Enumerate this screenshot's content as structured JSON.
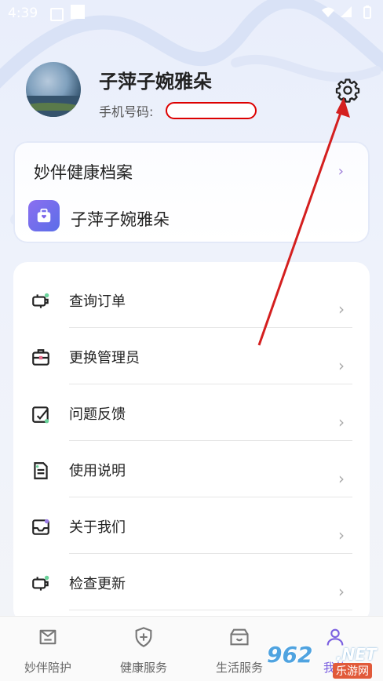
{
  "status_bar": {
    "time": "4:39"
  },
  "profile": {
    "name": "子萍子婉雅朵",
    "phone_label": "手机号码:"
  },
  "health_card": {
    "title": "妙伴健康档案",
    "chevron": "›",
    "record_name": "子萍子婉雅朵"
  },
  "menu": {
    "chevron": "›",
    "items": [
      {
        "label": "查询订单",
        "icon": "order-icon"
      },
      {
        "label": "更换管理员",
        "icon": "admin-icon"
      },
      {
        "label": "问题反馈",
        "icon": "feedback-icon"
      },
      {
        "label": "使用说明",
        "icon": "document-icon"
      },
      {
        "label": "关于我们",
        "icon": "about-icon"
      },
      {
        "label": "检查更新",
        "icon": "update-icon"
      }
    ]
  },
  "tabbar": {
    "tabs": [
      {
        "label": "妙伴陪护",
        "icon": "companion-icon"
      },
      {
        "label": "健康服务",
        "icon": "health-shield-icon"
      },
      {
        "label": "生活服务",
        "icon": "life-service-icon"
      },
      {
        "label": "我的",
        "icon": "profile-icon"
      }
    ]
  },
  "watermark": {
    "number": "962",
    "net": ".NET",
    "sub": "乐游网"
  },
  "colors": {
    "accent": "#7b5fe0",
    "arrow": "#d41f1f",
    "background": "#eef2fb"
  }
}
